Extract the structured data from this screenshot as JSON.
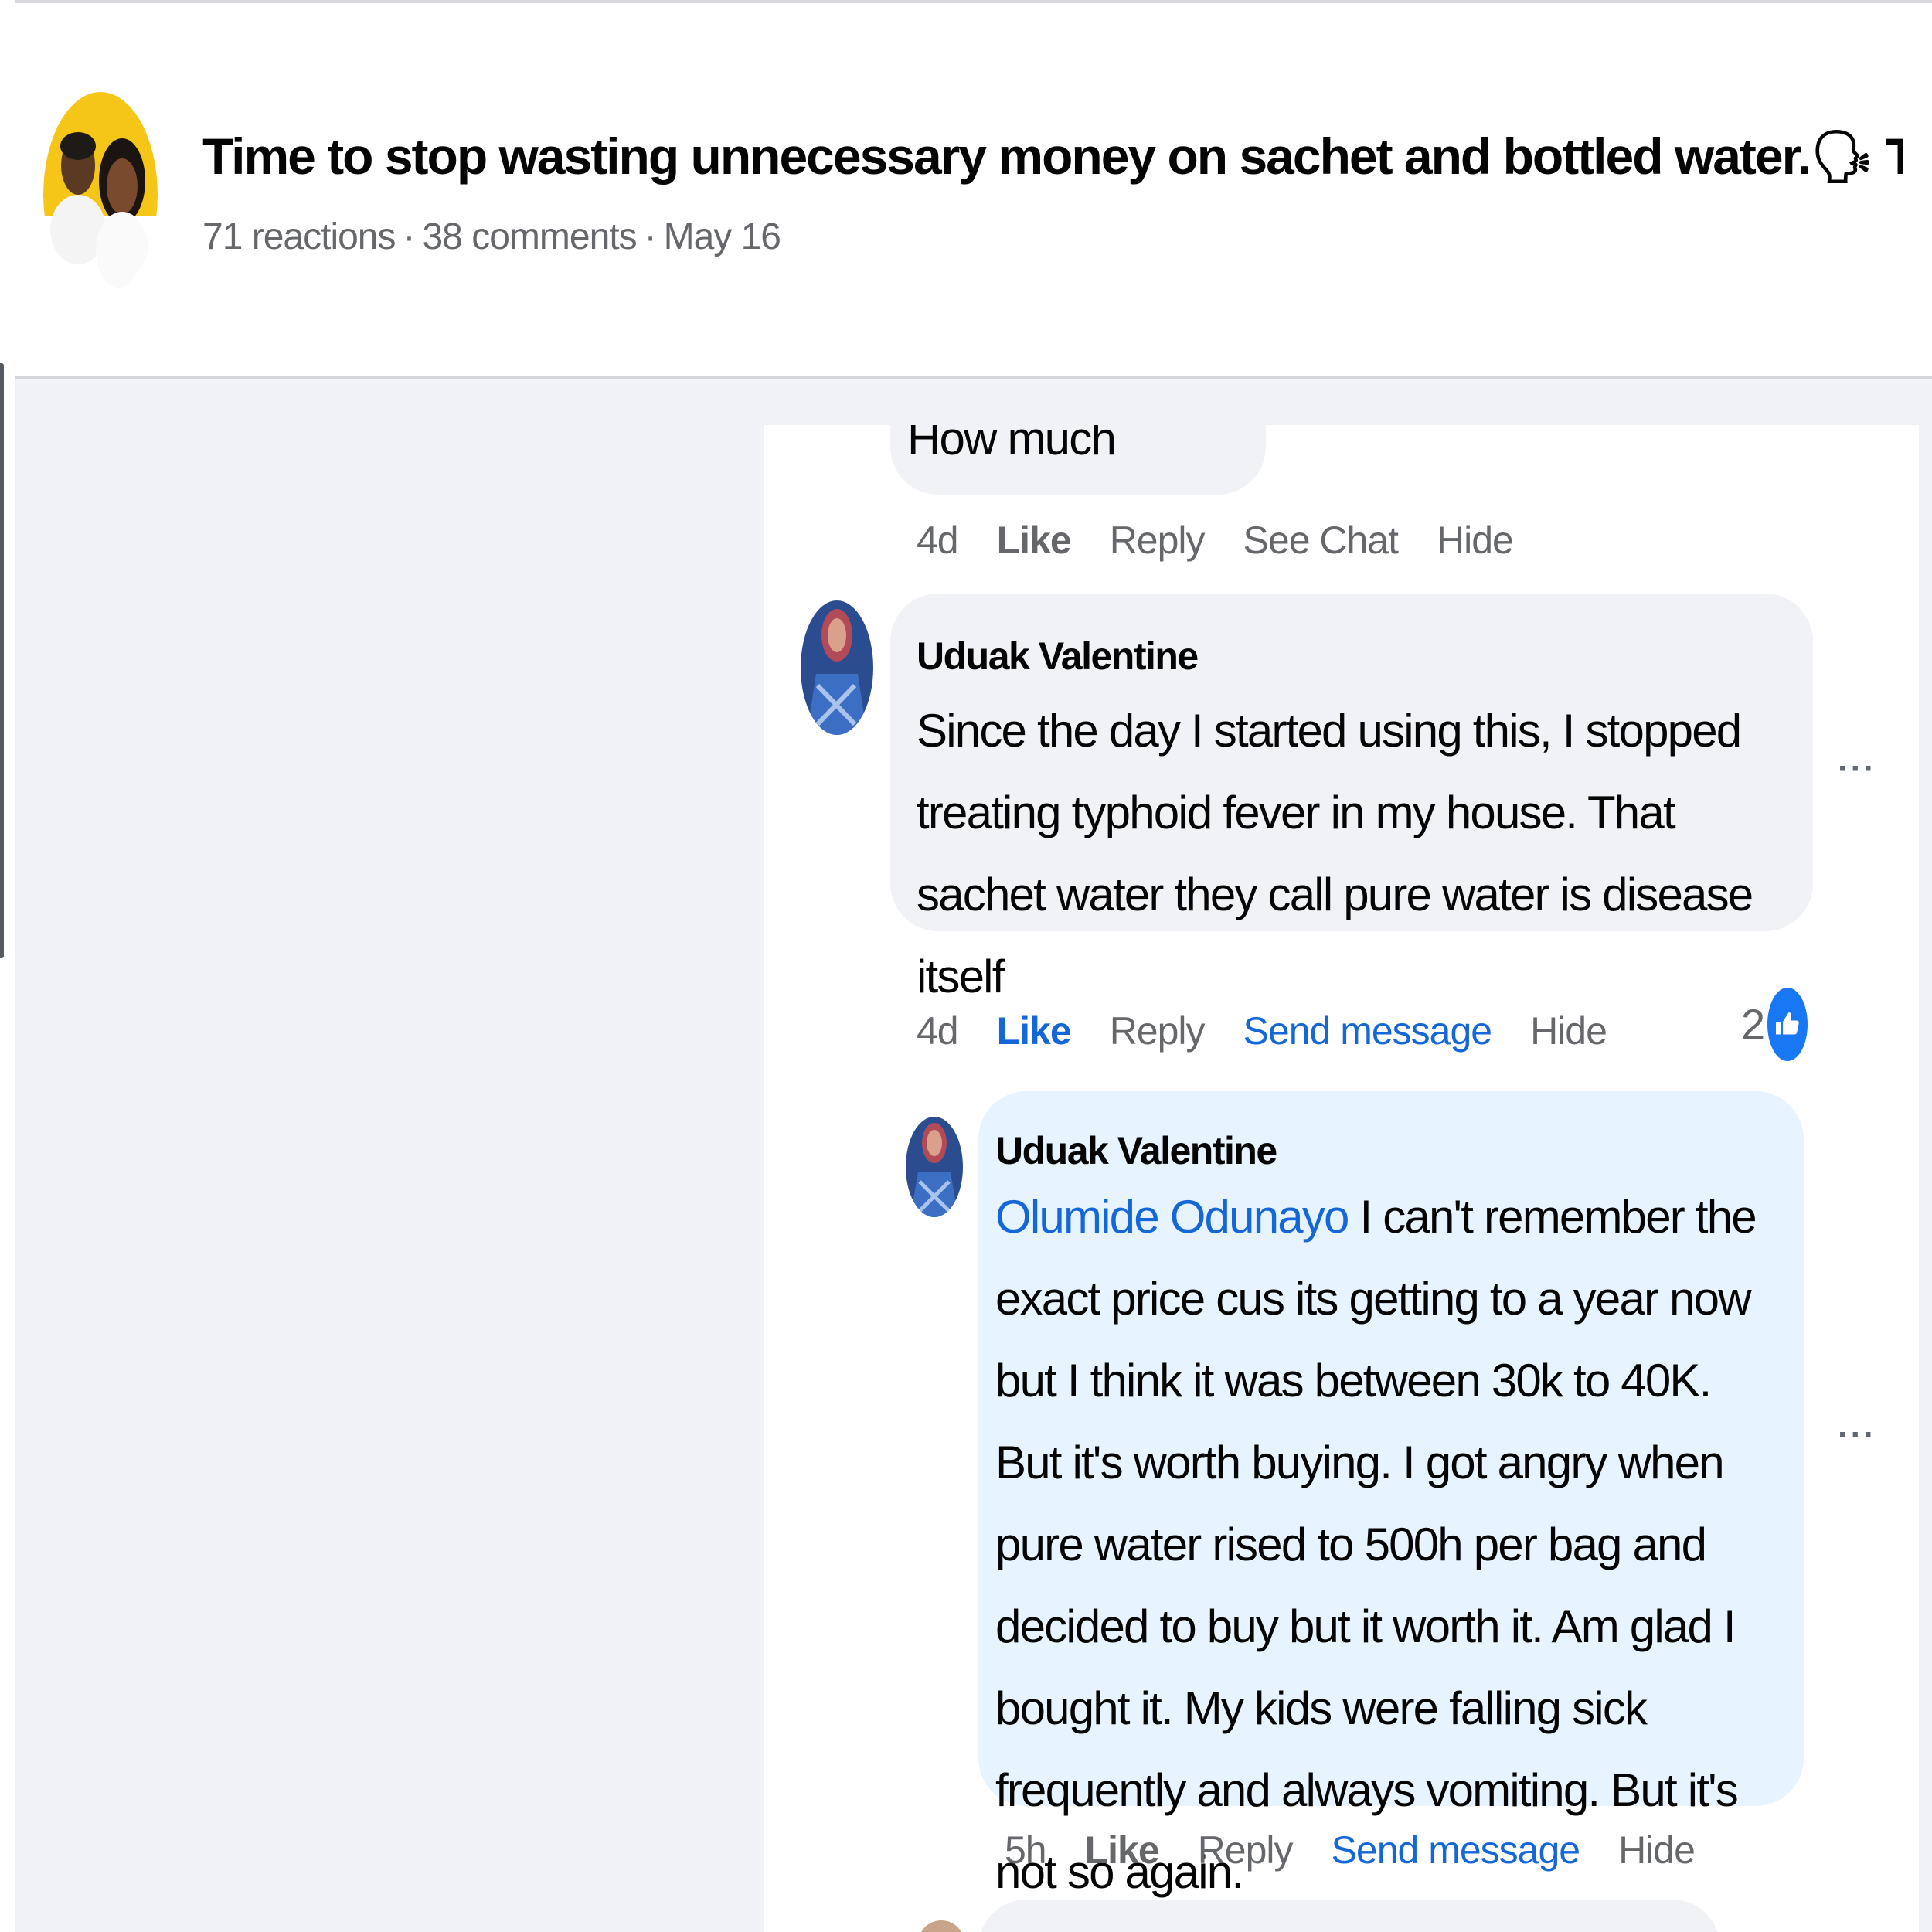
{
  "post": {
    "title": "Time to stop wasting unnecessary money on sachet and bottled water.🗣 This...",
    "reactions": "71 reactions",
    "comments": "38 comments",
    "date": "May 16",
    "separator": "·"
  },
  "previous_comment": {
    "text_fragment": "How much",
    "time": "4d",
    "like_label": "Like",
    "reply_label": "Reply",
    "see_chat_label": "See Chat",
    "hide_label": "Hide"
  },
  "comments": [
    {
      "author": "Uduak Valentine",
      "text": "Since the day I started using this, I stopped treating typhoid fever in my house. That sachet water they call pure water is disease itself",
      "time": "4d",
      "like_label": "Like",
      "reply_label": "Reply",
      "send_message_label": "Send message",
      "hide_label": "Hide",
      "reaction_count": "2",
      "more_label": "···"
    },
    {
      "author": "Uduak Valentine",
      "mention": "Olumide Odunayo",
      "text": " I can't remember the exact price cus its getting to a year now but I think it was between 30k to 40K. But it's worth buying. I got angry when pure water rised to 500h per bag and decided to buy but it worth it. Am glad I bought it. My kids were falling sick frequently and always vomiting. But it's not so again.",
      "time": "5h",
      "like_label": "Like",
      "reply_label": "Reply",
      "send_message_label": "Send message",
      "hide_label": "Hide",
      "more_label": "···"
    }
  ],
  "colors": {
    "link_blue": "#1567d8",
    "like_blue": "#1877f2",
    "bubble_gray": "#f0f2f5",
    "reply_bubble_blue": "#e7f3ff",
    "meta_gray": "#65676b"
  }
}
